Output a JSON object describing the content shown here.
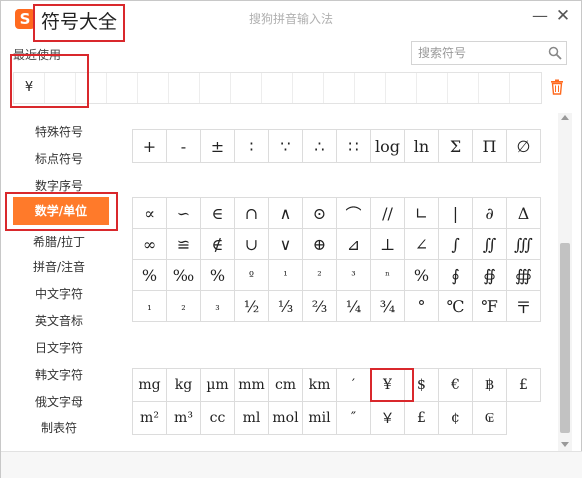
{
  "window": {
    "app_title": "符号大全",
    "ime_name": "搜狗拼音输入法",
    "logo_letter": "S",
    "minimize": "—",
    "close": "✕",
    "colors": {
      "accent": "#ff7a2a",
      "highlight": "#d9282c",
      "grid_border": "#dcdcdc"
    }
  },
  "recent": {
    "label": "最近使用",
    "items": [
      "¥",
      "",
      "",
      "",
      "",
      "",
      "",
      "",
      "",
      "",
      "",
      "",
      "",
      "",
      "",
      "",
      ""
    ]
  },
  "search": {
    "placeholder": "搜索符号",
    "icon": "search-icon"
  },
  "trash": {
    "icon": "trash-icon"
  },
  "sidebar": {
    "items": [
      {
        "label": "特殊符号"
      },
      {
        "label": "标点符号"
      },
      {
        "label": "数字序号"
      },
      {
        "label": "数学/单位",
        "active": true
      },
      {
        "label": "希腊/拉丁"
      },
      {
        "label": "拼音/注音"
      },
      {
        "label": "中文字符"
      },
      {
        "label": "英文音标"
      },
      {
        "label": "日文字符"
      },
      {
        "label": "韩文字符"
      },
      {
        "label": "俄文字母"
      },
      {
        "label": "制表符"
      }
    ]
  },
  "grids": {
    "top": [
      "+",
      "-",
      "±",
      "∶",
      "∵",
      "∴",
      "∷",
      "log",
      "ln",
      "Σ",
      "Π",
      "∅"
    ],
    "math": [
      "∝",
      "∽",
      "∈",
      "∩",
      "∧",
      "⊙",
      "⌒",
      "//",
      "∟",
      "|",
      "∂",
      "Δ",
      "∞",
      "≌",
      "∉",
      "∪",
      "∨",
      "⊕",
      "⊿",
      "⊥",
      "∠",
      "∫",
      "∬",
      "∭",
      "%",
      "‰",
      "%",
      "º",
      "¹",
      "²",
      "³",
      "ⁿ",
      "%",
      "∮",
      "∯",
      "∰",
      "₁",
      "₂",
      "₃",
      "½",
      "⅓",
      "⅔",
      "¼",
      "¾",
      "°",
      "℃",
      "℉",
      "〒"
    ],
    "units": [
      "mg",
      "kg",
      "µm",
      "mm",
      "cm",
      "km",
      "′",
      "¥",
      "$",
      "€",
      "฿",
      "£",
      "m²",
      "m³",
      "cc",
      "ml",
      "mol",
      "mil",
      "″",
      "￥",
      "£",
      "¢",
      "₢"
    ]
  }
}
